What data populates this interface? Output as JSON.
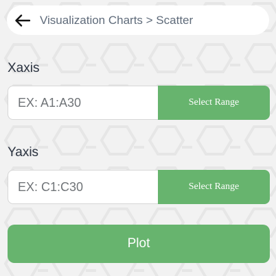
{
  "header": {
    "back_icon": "arrow-left-icon",
    "breadcrumb": "Visualization Charts > Scatter"
  },
  "xaxis": {
    "label": "Xaxis",
    "placeholder": "EX: A1:A30",
    "value": "",
    "button_label": "Select Range"
  },
  "yaxis": {
    "label": "Yaxis",
    "placeholder": "EX: C1:C30",
    "value": "",
    "button_label": "Select Range"
  },
  "plot": {
    "label": "Plot"
  },
  "colors": {
    "accent": "#67b46e",
    "background": "#f2f2f2",
    "surface": "#ffffff",
    "text_primary": "#2b3340",
    "text_secondary": "#5f6b7a"
  }
}
